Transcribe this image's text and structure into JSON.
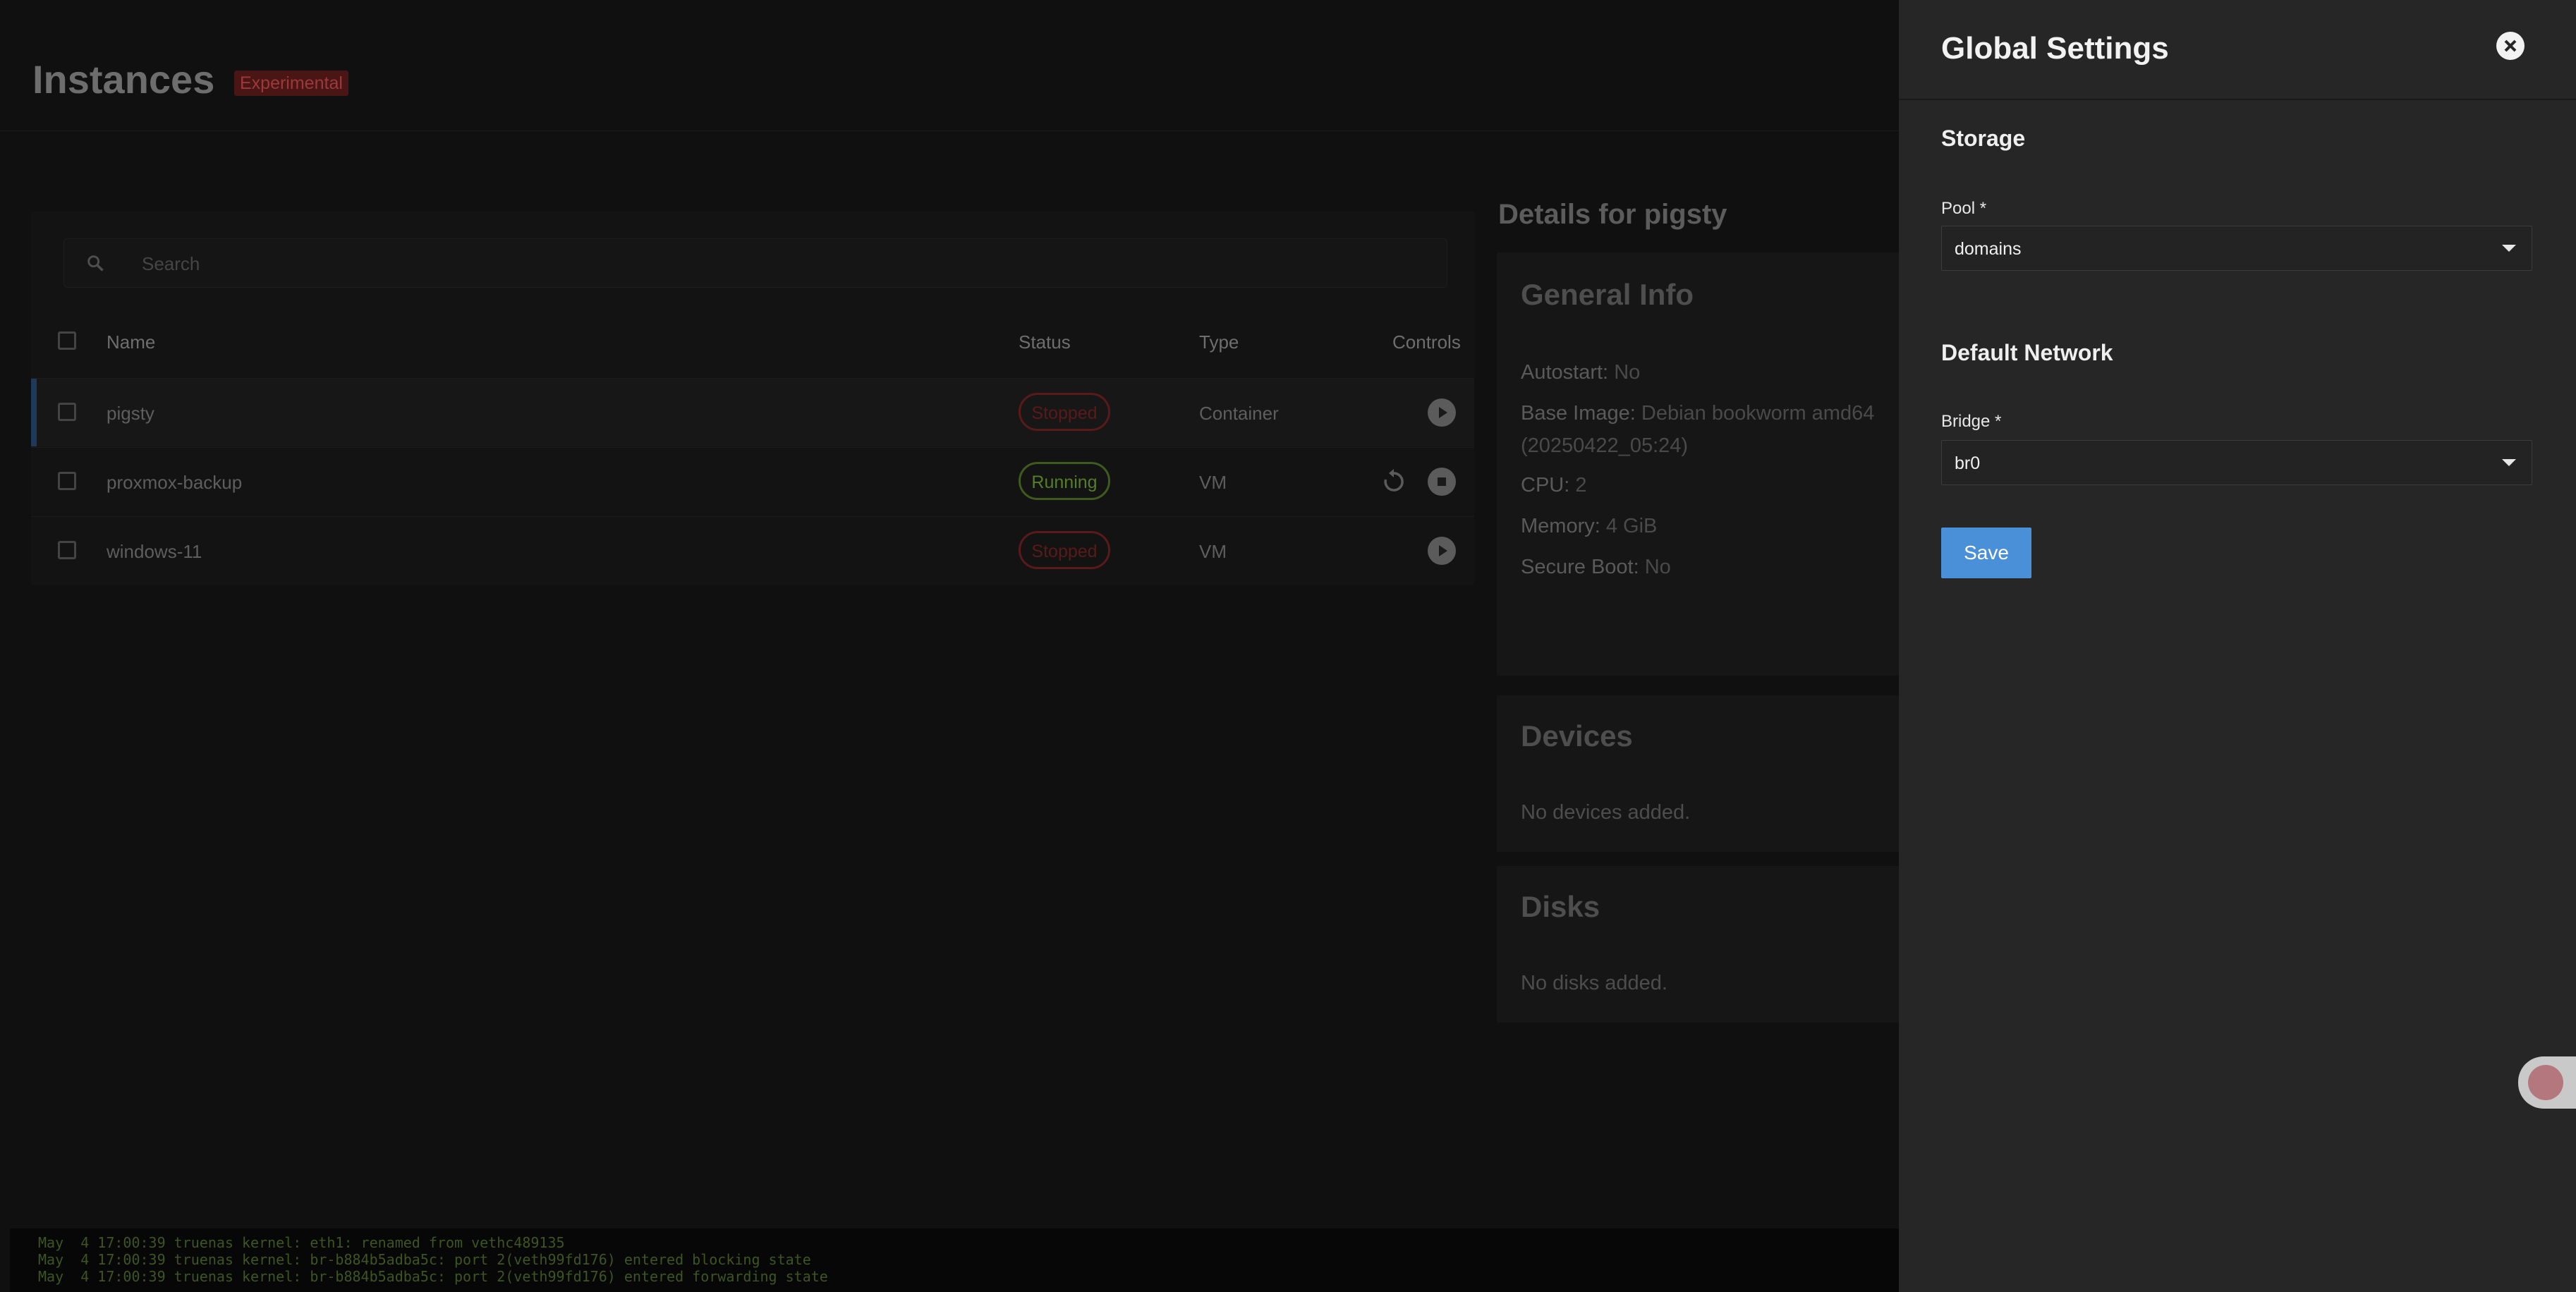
{
  "page": {
    "title": "Instances",
    "badge": "Experimental"
  },
  "search": {
    "placeholder": "Search"
  },
  "table": {
    "headers": {
      "name": "Name",
      "status": "Status",
      "type": "Type",
      "controls": "Controls"
    },
    "rows": [
      {
        "name": "pigsty",
        "status": "Stopped",
        "type": "Container"
      },
      {
        "name": "proxmox-backup",
        "status": "Running",
        "type": "VM"
      },
      {
        "name": "windows-11",
        "status": "Stopped",
        "type": "VM"
      }
    ]
  },
  "details": {
    "title": "Details for pigsty",
    "general_info": {
      "title": "General Info",
      "autostart_label": "Autostart:",
      "autostart_value": "No",
      "base_image_label": "Base Image:",
      "base_image_value": "Debian bookworm amd64",
      "base_image_value2": "(20250422_05:24)",
      "cpu_label": "CPU:",
      "cpu_value": "2",
      "memory_label": "Memory:",
      "memory_value": "4 GiB",
      "secure_boot_label": "Secure Boot:",
      "secure_boot_value": "No"
    },
    "devices": {
      "title": "Devices",
      "empty": "No devices added."
    },
    "disks": {
      "title": "Disks",
      "empty": "No disks added."
    }
  },
  "console": {
    "lines": [
      "May  4 17:00:39 truenas kernel: eth1: renamed from vethc489135",
      "May  4 17:00:39 truenas kernel: br-b884b5adba5c: port 2(veth99fd176) entered blocking state",
      "May  4 17:00:39 truenas kernel: br-b884b5adba5c: port 2(veth99fd176) entered forwarding state"
    ]
  },
  "drawer": {
    "title": "Global Settings",
    "storage": {
      "section_title": "Storage",
      "pool_label": "Pool *",
      "pool_value": "domains"
    },
    "network": {
      "section_title": "Default Network",
      "bridge_label": "Bridge *",
      "bridge_value": "br0"
    },
    "save_label": "Save"
  },
  "colors": {
    "accent": "#4a90d9",
    "running": "#567d2a",
    "stopped": "#5a1a1a"
  },
  "icons": {
    "search": "search-icon",
    "close": "close-icon",
    "play": "play-icon",
    "stop": "stop-icon",
    "restart": "restart-icon",
    "dropdown": "chevron-down-icon",
    "translate": "translate-icon"
  }
}
